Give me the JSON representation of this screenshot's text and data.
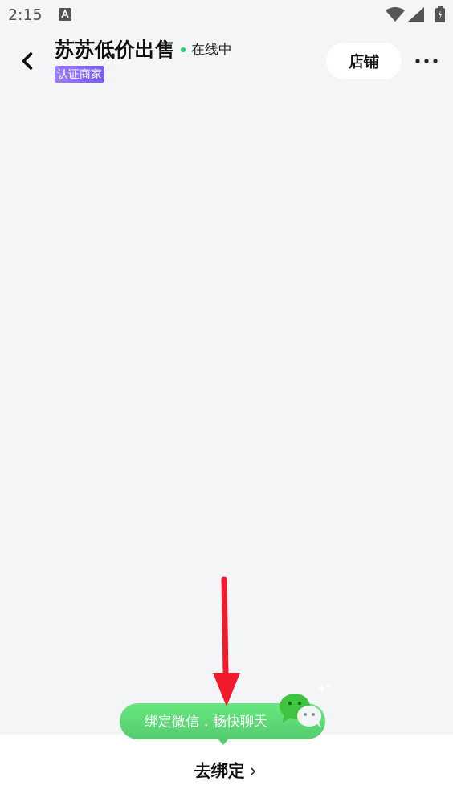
{
  "status_bar": {
    "time": "2:15"
  },
  "header": {
    "title": "苏苏低价出售",
    "online": true,
    "status": "在线中",
    "badge": "认证商家",
    "store_button": "店铺"
  },
  "bind_tip": {
    "text": "绑定微信，畅快聊天"
  },
  "bottom_bar": {
    "action": "去绑定"
  }
}
